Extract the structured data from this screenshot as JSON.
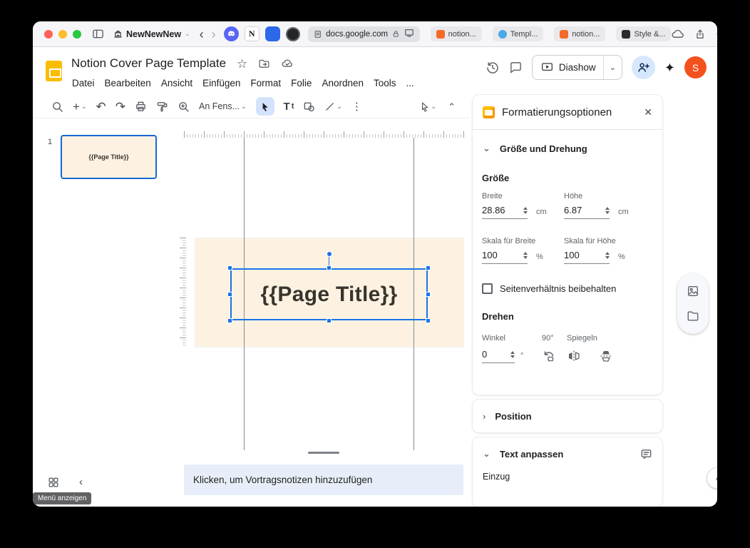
{
  "icons": {
    "chevron_down": "⌄",
    "chevron_up": "⌃",
    "chevron_left": "‹",
    "chevron_right": "›",
    "undo": "↶",
    "redo": "↷",
    "plus": "+",
    "dots_vertical": "⋮",
    "star": "☆",
    "sparkle": "✦",
    "close": "✕",
    "notion_letter": "N"
  },
  "browser": {
    "tab_group_name": "NewNewNew",
    "address": "docs.google.com",
    "tabs": [
      "notion...",
      "Templ...",
      "notion...",
      "Style &..."
    ]
  },
  "header": {
    "doc_title": "Notion Cover Page Template",
    "menu_items": [
      "Datei",
      "Bearbeiten",
      "Ansicht",
      "Einfügen",
      "Format",
      "Folie",
      "Anordnen",
      "Tools"
    ],
    "menu_overflow": "...",
    "present_button": "Diashow",
    "avatar_initial": "S"
  },
  "toolbar": {
    "zoom_fit_label": "An Fens...",
    "text_tool_cap": "T",
    "text_tool_low": "t"
  },
  "filmstrip": {
    "slide_number": "1",
    "thumbnail_text": "{{Page Title}}"
  },
  "canvas": {
    "textbox_text": "{{Page Title}}",
    "notes_placeholder": "Klicken, um Vortragsnotizen hinzuzufügen",
    "menu_tooltip": "Menü anzeigen"
  },
  "panel": {
    "title": "Formatierungsoptionen",
    "size_rotation": {
      "section_label": "Größe und Drehung",
      "size_label": "Größe",
      "width": {
        "label": "Breite",
        "value": "28.86",
        "unit": "cm"
      },
      "height": {
        "label": "Höhe",
        "value": "6.87",
        "unit": "cm"
      },
      "scale_width": {
        "label": "Skala für Breite",
        "value": "100",
        "unit": "%"
      },
      "scale_height": {
        "label": "Skala für Höhe",
        "value": "100",
        "unit": "%"
      },
      "aspect_label": "Seitenverhältnis beibehalten",
      "rotate_label": "Drehen",
      "angle": {
        "label": "Winkel",
        "value": "0",
        "unit": "°"
      },
      "rotate90_label": "90°",
      "flip_label": "Spiegeln"
    },
    "position_label": "Position",
    "text_fit": {
      "section_label": "Text anpassen",
      "indent_label": "Einzug"
    }
  },
  "colors": {
    "accent_blue": "#1a73e8",
    "slide_background": "#fdf2e2",
    "avatar_orange": "#f4511e",
    "slides_yellow": "#fbbc04",
    "share_button_blue": "#d7e7fd"
  }
}
